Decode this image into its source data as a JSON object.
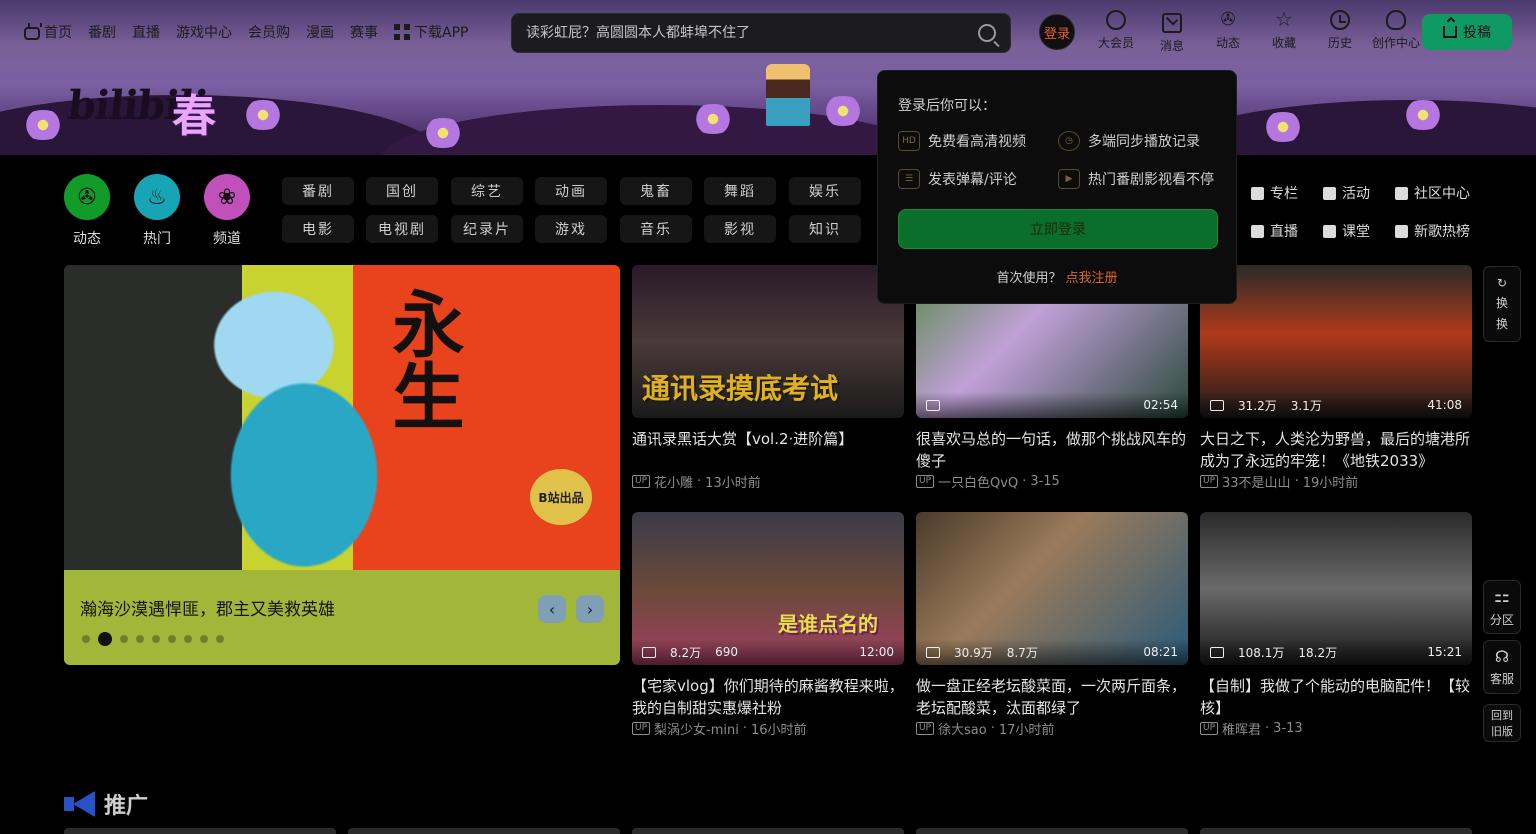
{
  "top_nav": {
    "items": [
      "首页",
      "番剧",
      "直播",
      "游戏中心",
      "会员购",
      "漫画",
      "赛事",
      "下载APP"
    ]
  },
  "search": {
    "placeholder": "读彩虹屁？高圆圆本人都蚌埠不住了"
  },
  "login_circle": "登录",
  "right_nav": {
    "items": [
      {
        "label": "大会员",
        "icon": "vip-icon"
      },
      {
        "label": "消息",
        "icon": "mail-icon"
      },
      {
        "label": "动态",
        "icon": "fan-icon"
      },
      {
        "label": "收藏",
        "icon": "star-icon"
      },
      {
        "label": "历史",
        "icon": "clock-icon"
      },
      {
        "label": "创作中心",
        "icon": "bulb-icon"
      }
    ],
    "upload": "投稿"
  },
  "channels": [
    {
      "label": "动态",
      "color": "#139b2a",
      "icon": "✇"
    },
    {
      "label": "热门",
      "color": "#17a4b4",
      "icon": "♨"
    },
    {
      "label": "频道",
      "color": "#c250ba",
      "icon": "❀"
    }
  ],
  "categories_row1": [
    "番剧",
    "国创",
    "综艺",
    "动画",
    "鬼畜",
    "舞蹈",
    "娱乐"
  ],
  "categories_row2": [
    "电影",
    "电视剧",
    "纪录片",
    "游戏",
    "音乐",
    "影视",
    "知识"
  ],
  "side_links_row1": [
    "专栏",
    "活动",
    "社区中心"
  ],
  "side_links_row2": [
    "直播",
    "课堂",
    "新歌热榜"
  ],
  "hero": {
    "caption": "瀚海沙漠遇悍匪，郡主又美救英雄",
    "title_art": "永生",
    "stamp": "B站出品",
    "prev": "‹",
    "next": "›",
    "dot_count": 9,
    "active_dot": 1
  },
  "cards": [
    {
      "title": "通讯录黑话大赏【vol.2·进阶篇】",
      "author": "花小雕",
      "time": "13小时前",
      "views": "",
      "danmaku": "",
      "duration": "",
      "overlay": "通讯录摸底考试",
      "bg": "linear-gradient(180deg,#2a1a2a 0%,#4a3a3a 50%,#1a1a1a 100%)"
    },
    {
      "title": "很喜欢马总的一句话，做那个挑战风车的傻子",
      "author": "一只白色QvQ",
      "time": "3-15",
      "views": "",
      "danmaku": "",
      "duration": "02:54",
      "overlay": "",
      "bg": "linear-gradient(135deg,#5a8a4a 0%,#c0a0d8 40%,#2a4a3a 100%)"
    },
    {
      "title": "大日之下，人类沦为野兽，最后的塘港所成为了永远的牢笼！《地铁2033》",
      "author": "33不是山山",
      "time": "19小时前",
      "views": "31.2万",
      "danmaku": "3.1万",
      "duration": "41:08",
      "overlay": "",
      "bg": "linear-gradient(180deg,#2a2a2a 0%,#b03a1a 45%,#1a1a1a 100%)"
    },
    {
      "title": "【宅家vlog】你们期待的麻酱教程来啦，我的自制甜实惠爆社粉",
      "author": "梨涡少女-mini",
      "time": "16小时前",
      "views": "8.2万",
      "danmaku": "690",
      "duration": "12:00",
      "overlay": "是谁点名的",
      "bg": "linear-gradient(180deg,#3a3a4a 0%,#6a4a3a 50%,#a04060 100%)"
    },
    {
      "title": "做一盘正经老坛酸菜面，一次两斤面条，老坛配酸菜，汰面都绿了",
      "author": "徐大sao",
      "time": "17小时前",
      "views": "30.9万",
      "danmaku": "8.7万",
      "duration": "08:21",
      "overlay": "",
      "bg": "linear-gradient(135deg,#4a3a2a 0%,#9a7a5a 40%,#2a5a7a 100%)"
    },
    {
      "title": "【自制】我做了个能动的电脑配件！【较核】",
      "author": "稚晖君",
      "time": "3-13",
      "views": "108.1万",
      "danmaku": "18.2万",
      "duration": "15:21",
      "overlay": "",
      "bg": "linear-gradient(180deg,#2a2a2a 0%,#6a6a6a 50%,#1a1a1a 100%)"
    }
  ],
  "float": {
    "refresh": [
      "换",
      "换"
    ],
    "section": "分区",
    "service": "客服",
    "old": "回到旧版"
  },
  "popover": {
    "title": "登录后你可以：",
    "benefits": [
      {
        "text": "免费看高清视频",
        "icon": "hd-icon"
      },
      {
        "text": "多端同步播放记录",
        "icon": "history-icon"
      },
      {
        "text": "发表弹幕/评论",
        "icon": "danmaku-icon"
      },
      {
        "text": "热门番剧影视看不停",
        "icon": "tv-icon"
      }
    ],
    "login_button": "立即登录",
    "register_prompt": "首次使用？",
    "register_link": "点我注册"
  },
  "promo": {
    "label": "推广"
  },
  "colors": {
    "accent": "#0f9a62",
    "login_orange": "#e0642a"
  }
}
